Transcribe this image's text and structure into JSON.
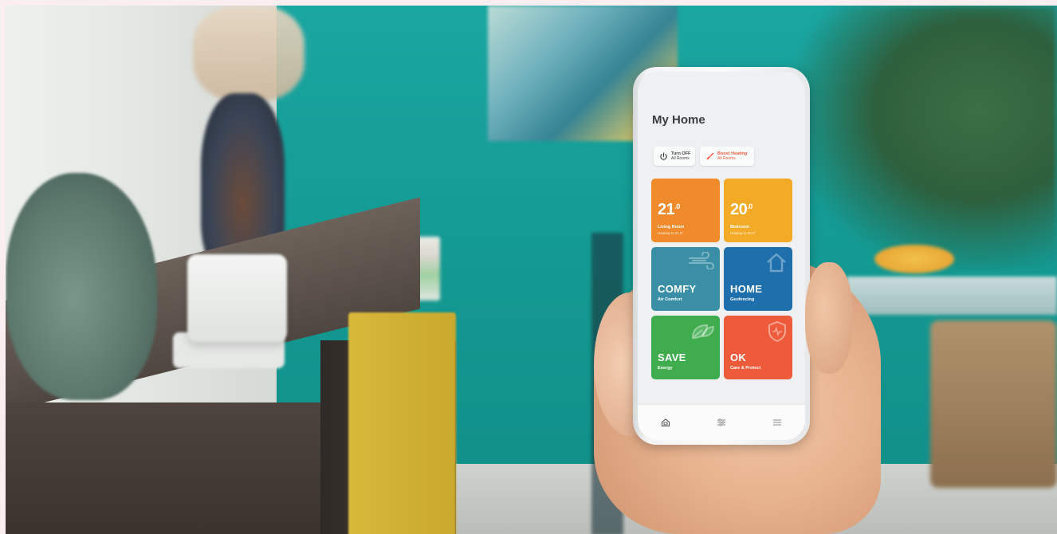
{
  "app": {
    "title": "My Home",
    "quick_actions": [
      {
        "label": "Turn OFF",
        "sub": "All Rooms",
        "icon": "power-icon"
      },
      {
        "label": "Boost Heating",
        "sub": "All Rooms",
        "icon": "rocket-icon"
      }
    ],
    "tiles": [
      {
        "value": "21",
        "decimal": ".0",
        "label": "Living Room",
        "sub": "Heating to 21.0°",
        "color": "#f08a2a"
      },
      {
        "value": "20",
        "decimal": ".0",
        "label": "Bedroom",
        "sub": "Heating to 20.0°",
        "color": "#f3ab27"
      },
      {
        "word": "COMFY",
        "sub": "Air Comfort",
        "icon": "wind-icon",
        "color": "#3a8fa6"
      },
      {
        "word": "HOME",
        "sub": "Geofencing",
        "icon": "house-icon",
        "color": "#1e6fab"
      },
      {
        "word": "SAVE",
        "sub": "Energy",
        "icon": "leaf-icon",
        "color": "#3fac4e"
      },
      {
        "word": "OK",
        "sub": "Care & Protect",
        "icon": "shield-icon",
        "color": "#ee5b3b"
      }
    ],
    "nav": [
      "home-nav-icon",
      "settings-sliders-icon",
      "menu-icon"
    ]
  }
}
